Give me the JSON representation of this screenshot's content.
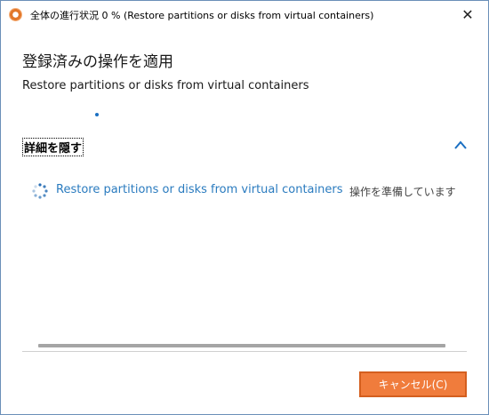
{
  "window": {
    "title": "全体の進行状況 0 % (Restore partitions or disks from virtual containers)",
    "close_label": "✕",
    "app_icon": "app-logo-icon"
  },
  "operation": {
    "heading": "登録済みの操作を適用",
    "subtitle": "Restore partitions or disks from virtual containers",
    "progress_percent": 0
  },
  "details": {
    "toggle_label": "詳細を隠す",
    "toggle_icon": "chevron-up-icon",
    "tasks": [
      {
        "name": "Restore partitions or disks from virtual containers",
        "status": "操作を準備しています",
        "icon": "spinner-icon"
      }
    ]
  },
  "footer": {
    "cancel_label": "キャンセル(C)"
  },
  "colors": {
    "accent_blue": "#2a7bbf",
    "cancel_orange": "#f07c3c"
  }
}
